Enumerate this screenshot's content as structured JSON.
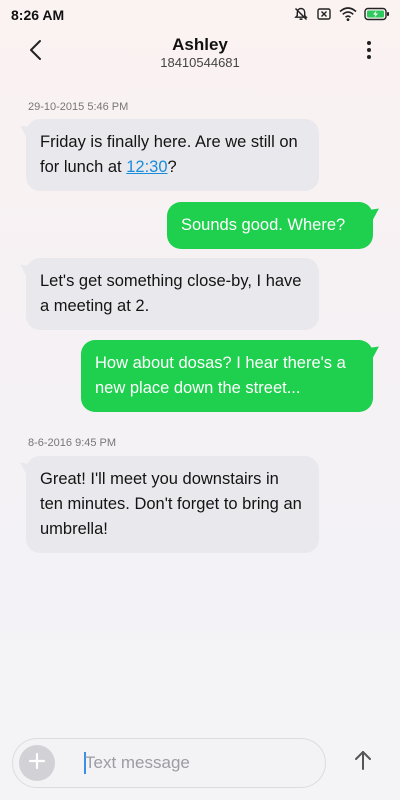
{
  "status_bar": {
    "time": "8:26 AM"
  },
  "header": {
    "name": "Ashley",
    "number": "18410544681"
  },
  "messages": {
    "timestamp_1": "29-10-2015 5:46 PM",
    "m1_before": "Friday is finally here. Are we still on for lunch at ",
    "m1_link": "12:30",
    "m1_after": "?",
    "m2": "Sounds good. Where?",
    "m3": "Let's get something close-by, I have a meeting at 2.",
    "m4": "How about dosas? I hear there's a new place down the street...",
    "timestamp_2": "8-6-2016 9:45 PM",
    "m5": "Great! I'll meet you downstairs in ten minutes. Don't forget to bring an umbrella!"
  },
  "composer": {
    "placeholder": "Text message"
  },
  "colors": {
    "outgoing_bubble": "#1ed04d",
    "incoming_bubble": "#e9e8ec",
    "link": "#1a8cdc",
    "battery_charging": "#2ec95c"
  },
  "icons": {
    "status": [
      "alarm-off-icon",
      "no-sim-icon",
      "wifi-icon",
      "battery-charging-icon"
    ],
    "header": [
      "back-arrow-icon",
      "more-vertical-icon"
    ],
    "composer": [
      "plus-icon",
      "send-arrow-icon"
    ]
  }
}
